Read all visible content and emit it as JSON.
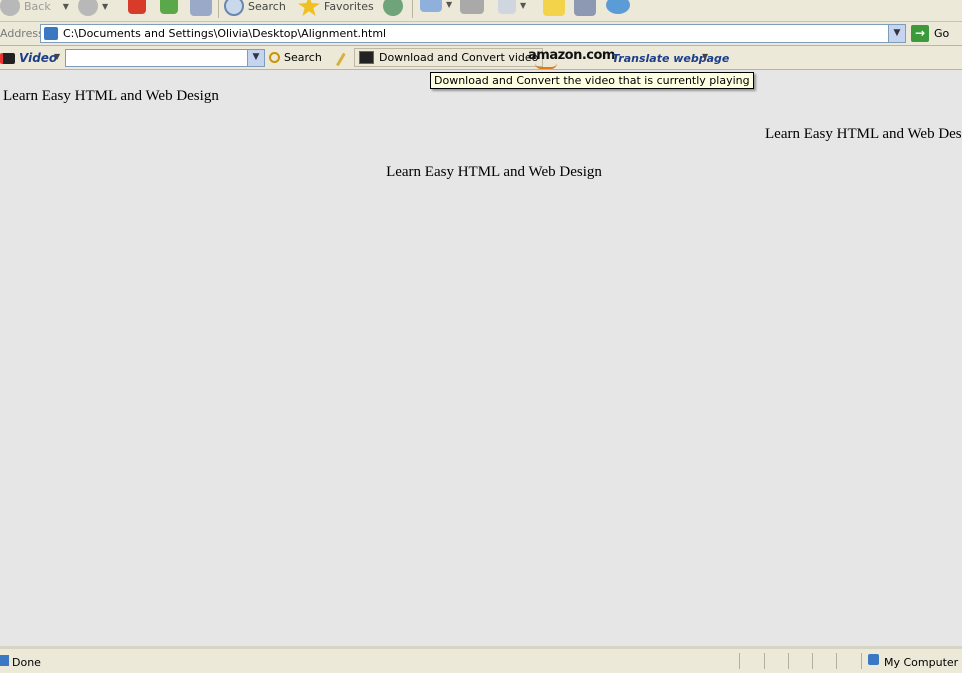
{
  "toolbar": {
    "back_label": "Back",
    "search_label": "Search",
    "favorites_label": "Favorites"
  },
  "address_bar": {
    "label": "Address",
    "value": "C:\\Documents and Settings\\Olivia\\Desktop\\Alignment.html",
    "go_label": "Go"
  },
  "video_toolbar": {
    "video_label": "Video",
    "search_label": "Search",
    "download_label": "Download and Convert video",
    "amazon_label": "amazon.com",
    "translate_label": "Translate webpage"
  },
  "tooltip": {
    "text": "Download and Convert the video that is currently playing"
  },
  "content": {
    "lines": [
      {
        "text": "Learn Easy HTML and Web Design",
        "align": "left"
      },
      {
        "text": "Learn Easy HTML and Web Design",
        "align": "right"
      },
      {
        "text": "Learn Easy HTML and Web Design",
        "align": "center"
      }
    ]
  },
  "status_bar": {
    "status": "Done",
    "zone": "My Computer"
  },
  "colors": {
    "chrome": "#ece9d8",
    "page_background": "#e6e6e6",
    "tooltip_background": "#ffffe1",
    "go_green": "#3d9a3a"
  }
}
